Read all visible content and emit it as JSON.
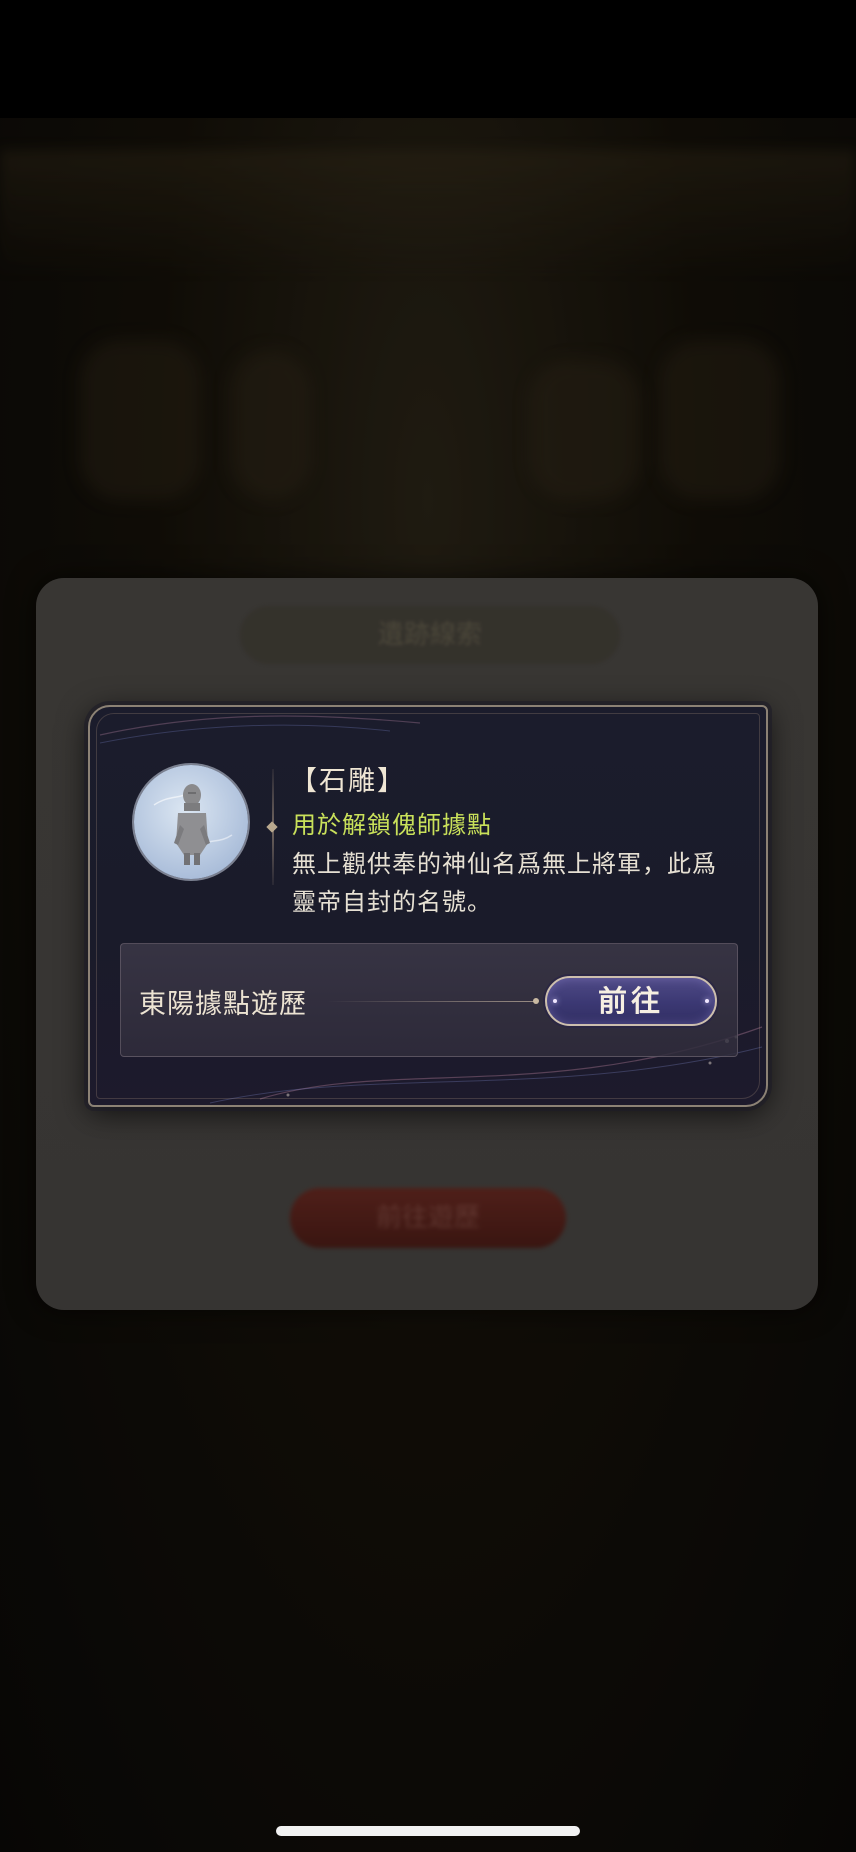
{
  "background": {
    "card_title": "遺跡線索",
    "red_button_label": "前往遊歷"
  },
  "popup": {
    "item_name": "【石雕】",
    "item_usage": "用於解鎖傀師據點",
    "item_description": "無上觀供奉的神仙名爲無上將軍，此爲靈帝自封的名號。",
    "source": {
      "label": "東陽據點遊歷",
      "goto_label": "前往"
    },
    "icon": "stone-statue-icon"
  },
  "colors": {
    "usage_text": "#c9e15a",
    "popup_bg": "#1b1c2c",
    "goto_button": "#3b3873"
  }
}
